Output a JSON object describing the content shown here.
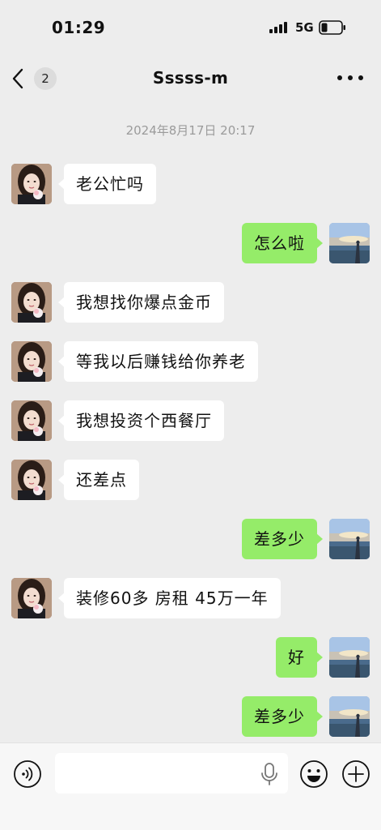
{
  "status": {
    "time": "01:29",
    "network": "5G"
  },
  "nav": {
    "unread_count": "2",
    "title": "Sssss-m"
  },
  "conversation": {
    "timestamp": "2024年8月17日 20:17",
    "messages": [
      {
        "side": "left",
        "text": "老公忙吗"
      },
      {
        "side": "right",
        "text": "怎么啦"
      },
      {
        "side": "left",
        "text": "我想找你爆点金币"
      },
      {
        "side": "left",
        "text": "等我以后赚钱给你养老"
      },
      {
        "side": "left",
        "text": "我想投资个西餐厅"
      },
      {
        "side": "left",
        "text": "还差点"
      },
      {
        "side": "right",
        "text": "差多少"
      },
      {
        "side": "left",
        "text": "装修60多 房租 45万一年"
      },
      {
        "side": "right",
        "text": "好"
      },
      {
        "side": "right",
        "text": "差多少"
      }
    ]
  },
  "input": {
    "value": "",
    "placeholder": ""
  },
  "colors": {
    "background": "#ededed",
    "sent_bubble": "#95ec69",
    "received_bubble": "#ffffff",
    "timestamp_text": "#9b9b9b"
  },
  "icons": {
    "back": "chevron-left-icon",
    "more": "more-icon",
    "voice": "voice-icon",
    "mic": "mic-icon",
    "emoji": "emoji-icon",
    "plus": "plus-icon"
  }
}
